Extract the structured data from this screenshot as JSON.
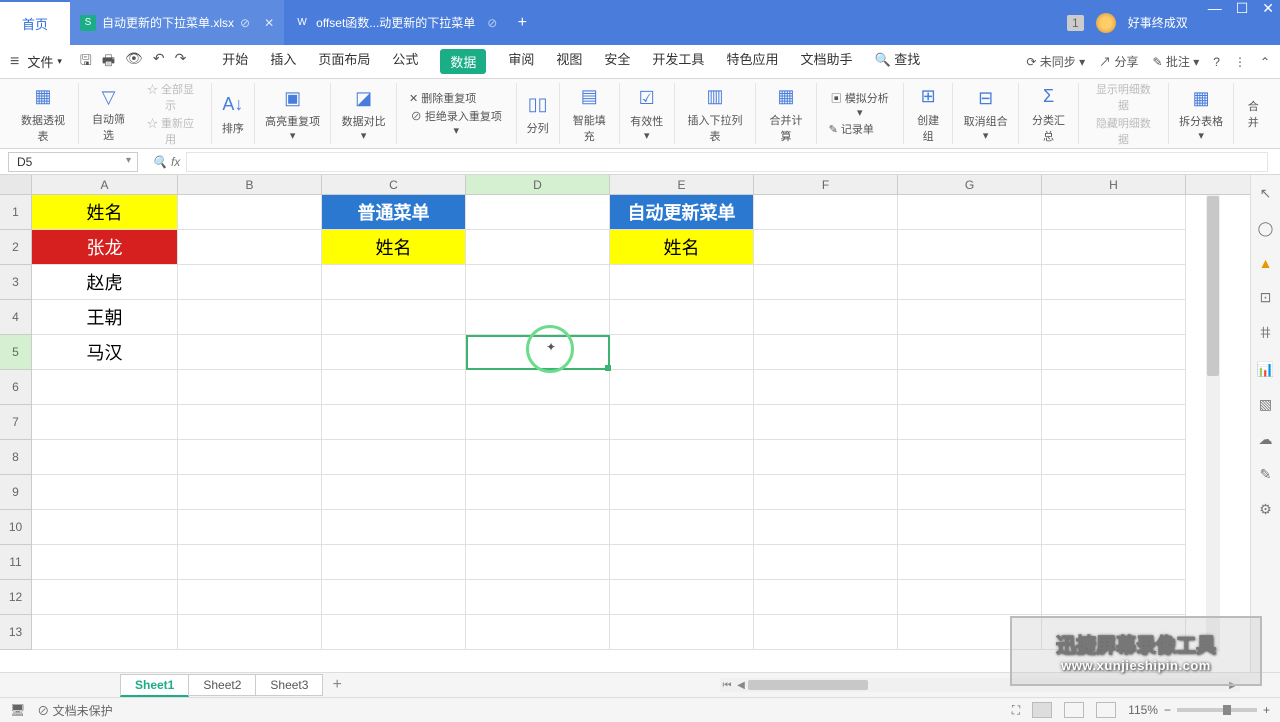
{
  "title": {
    "home_tab": "首页",
    "file1": "自动更新的下拉菜单.xlsx",
    "file2": "offset函数...动更新的下拉菜单",
    "username": "好事终成双",
    "badge": "1"
  },
  "menu": {
    "file": "文件",
    "tabs": [
      "开始",
      "插入",
      "页面布局",
      "公式",
      "数据",
      "审阅",
      "视图",
      "安全",
      "开发工具",
      "特色应用",
      "文档助手"
    ],
    "active_index": 4,
    "search": "查找",
    "right": {
      "sync": "未同步",
      "share": "分享",
      "approve": "批注"
    }
  },
  "ribbon": {
    "pivot": "数据透视表",
    "autofilter": "自动筛选",
    "showall": "全部显示",
    "reapply": "重新应用",
    "sort": "排序",
    "highlight": "高亮重复项",
    "compare": "数据对比",
    "removeDup": "删除重复项",
    "rejectDup": "拒绝录入重复项",
    "splitCol": "分列",
    "smartFill": "智能填充",
    "validation": "有效性",
    "insertList": "插入下拉列表",
    "consolidate": "合并计算",
    "whatif": "模拟分析",
    "record": "记录单",
    "group": "创建组",
    "ungroup": "取消组合",
    "subtotal": "分类汇总",
    "showDetail": "显示明细数据",
    "hideDetail": "隐藏明细数据",
    "splitTable": "拆分表格",
    "merge": "合并"
  },
  "formula": {
    "cellref": "D5",
    "fx": "fx"
  },
  "columns": [
    "A",
    "B",
    "C",
    "D",
    "E",
    "F",
    "G",
    "H"
  ],
  "rows": [
    "1",
    "2",
    "3",
    "4",
    "5",
    "6",
    "7",
    "8",
    "9",
    "10",
    "11",
    "12",
    "13"
  ],
  "cells": {
    "A1": "姓名",
    "A2": "张龙",
    "A3": "赵虎",
    "A4": "王朝",
    "A5": "马汉",
    "C1": "普通菜单",
    "C2": "姓名",
    "E1": "自动更新菜单",
    "E2": "姓名"
  },
  "sheets": {
    "names": [
      "Sheet1",
      "Sheet2",
      "Sheet3"
    ],
    "active": 0
  },
  "status": {
    "protect": "文档未保护",
    "zoom": "115%"
  },
  "watermark": {
    "line1": "迅捷屏幕录像工具",
    "line2": "www.xunjieshipin.com"
  }
}
